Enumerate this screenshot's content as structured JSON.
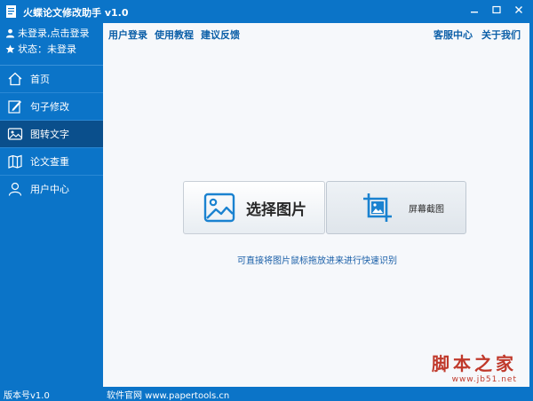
{
  "window": {
    "title": "火蝶论文修改助手 v1.0",
    "accent_color": "#0b74c8",
    "active_color": "#0a4f8c"
  },
  "user": {
    "login_text": "未登录,点击登录",
    "status_text": "状态：未登录"
  },
  "sidebar": {
    "items": [
      {
        "label": "首页",
        "icon": "home-icon"
      },
      {
        "label": "句子修改",
        "icon": "edit-icon"
      },
      {
        "label": "图转文字",
        "icon": "image-icon",
        "active": true
      },
      {
        "label": "论文查重",
        "icon": "map-icon"
      },
      {
        "label": "用户中心",
        "icon": "user-icon"
      }
    ]
  },
  "menu": {
    "left": [
      "用户登录",
      "使用教程",
      "建议反馈"
    ],
    "right": [
      "客服中心",
      "关于我们"
    ]
  },
  "main": {
    "select_button": "选择图片",
    "capture_button": "屏幕截图",
    "hint": "可直接将图片鼠标拖放进来进行快速识别"
  },
  "watermark": {
    "big": "脚本之家",
    "small": "www.jb51.net"
  },
  "status": {
    "version": "版本号v1.0",
    "site": "软件官网 www.papertools.cn"
  }
}
